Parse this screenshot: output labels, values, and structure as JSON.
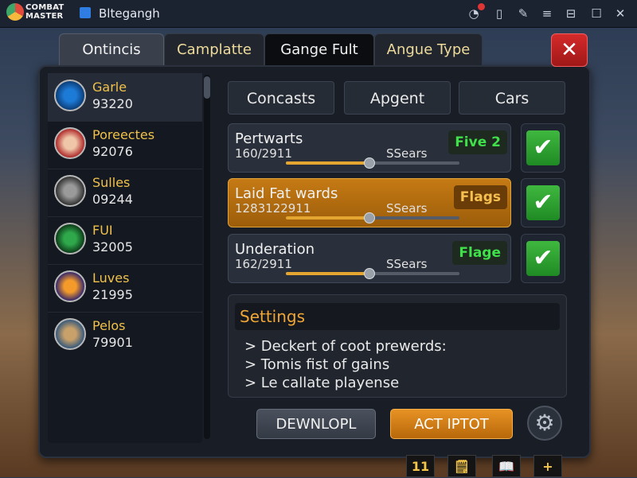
{
  "titlebar": {
    "logo_line1": "COMBAT",
    "logo_line2": "MASTER",
    "app_title": "Bltegangh",
    "icons": [
      "notification-icon",
      "phone-icon",
      "pen-icon",
      "menu-icon",
      "restore-icon",
      "maximize-icon",
      "close-icon"
    ]
  },
  "tabs": [
    {
      "label": "Ontincis"
    },
    {
      "label": "Camplatte"
    },
    {
      "label": "Gange Fult"
    },
    {
      "label": "Angue Type"
    }
  ],
  "close_label": "✕",
  "list": [
    {
      "name": "Garle",
      "value": "93220"
    },
    {
      "name": "Poreectes",
      "value": "92076"
    },
    {
      "name": "Sulles",
      "value": "09244"
    },
    {
      "name": "FUI",
      "value": "32005"
    },
    {
      "name": "Luves",
      "value": "21995"
    },
    {
      "name": "Pelos",
      "value": "79901"
    }
  ],
  "segments": [
    {
      "label": "Concasts"
    },
    {
      "label": "Apgent"
    },
    {
      "label": "Cars"
    }
  ],
  "rows": [
    {
      "title": "Pertwarts",
      "sub": "160/2911",
      "sears": "SSears",
      "badge": "Five 2",
      "level": 0.48
    },
    {
      "title": "Laid Fat wards",
      "sub": "1283122911",
      "sears": "SSears",
      "badge": "Flags",
      "level": 0.48
    },
    {
      "title": "Underation",
      "sub": "162/2911",
      "sears": "SSears",
      "badge": "Flage",
      "level": 0.48
    }
  ],
  "settings": {
    "heading": "Settings",
    "lines": [
      "> Deckert of coot prewerds:",
      "> Tomis fist of gains",
      "> Le callate playense"
    ]
  },
  "buttons": {
    "download": "DEWNLOPL",
    "action": "ACT IPTOT"
  },
  "bottombar": [
    "11",
    "🗒",
    "📖",
    "+"
  ],
  "colors": {
    "accent_orange": "#e79224",
    "accent_green": "#3fe04a",
    "name_gold": "#f0c14b",
    "close_red": "#d42a2a"
  }
}
